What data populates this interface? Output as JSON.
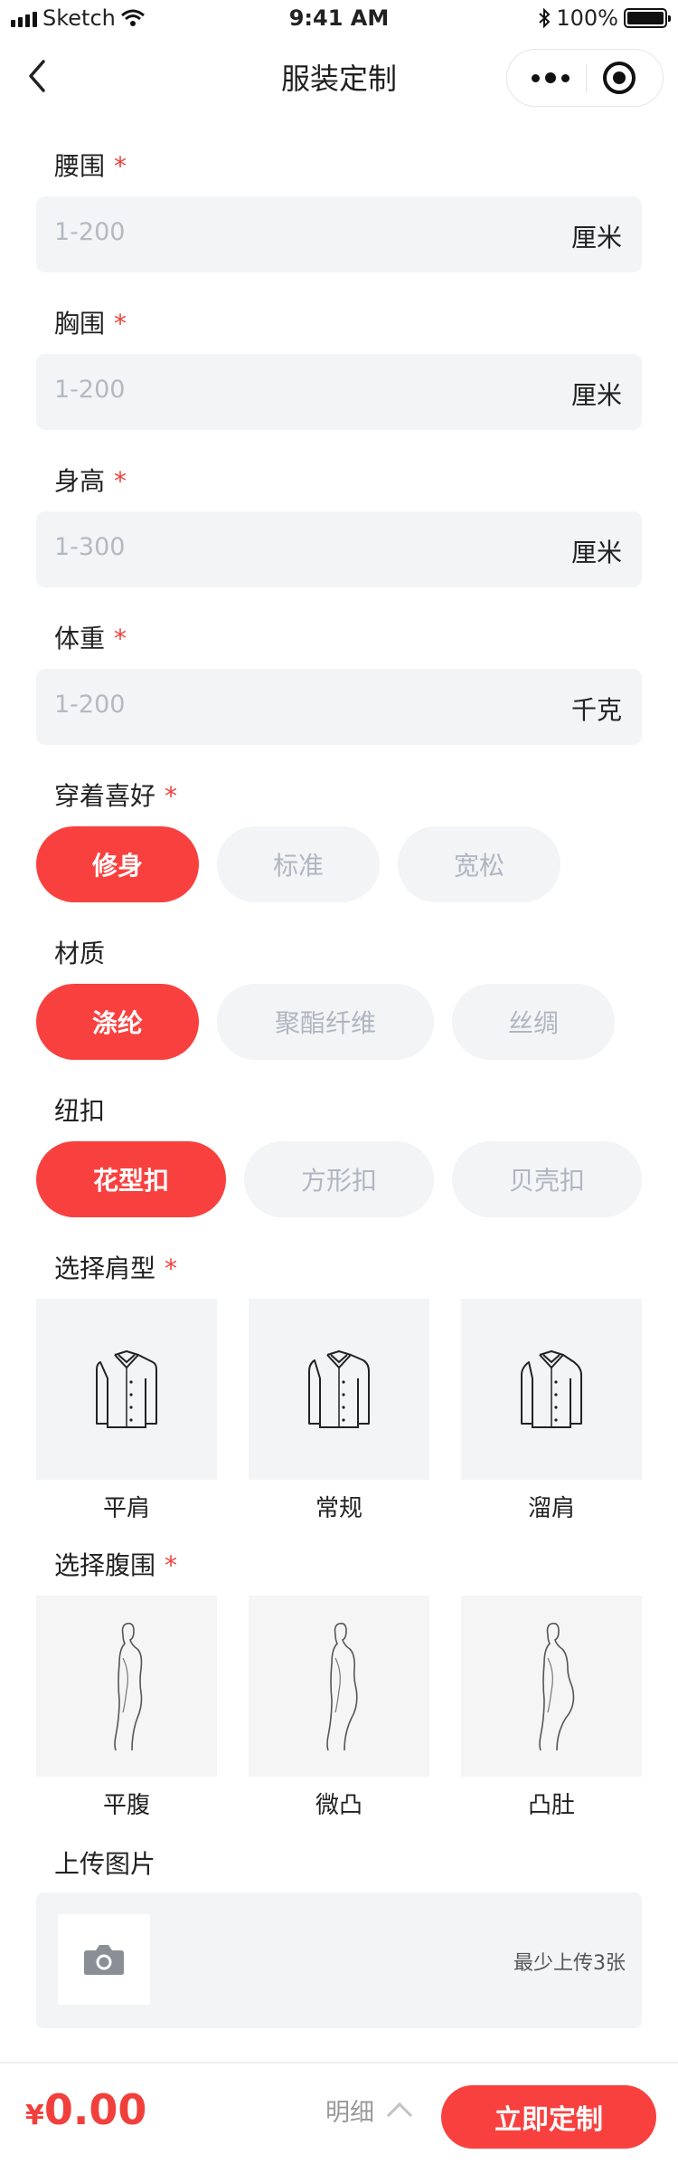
{
  "status_bar": {
    "carrier": "Sketch",
    "time": "9:41 AM",
    "battery": "100%"
  },
  "nav": {
    "title": "服装定制"
  },
  "measurements": [
    {
      "label": "腰围",
      "required": "*",
      "placeholder": "1-200",
      "unit": "厘米"
    },
    {
      "label": "胸围",
      "required": "*",
      "placeholder": "1-200",
      "unit": "厘米"
    },
    {
      "label": "身高",
      "required": "*",
      "placeholder": "1-300",
      "unit": "厘米"
    },
    {
      "label": "体重",
      "required": "*",
      "placeholder": "1-200",
      "unit": "千克"
    }
  ],
  "preference": {
    "label": "穿着喜好",
    "required": "*",
    "options": [
      "修身",
      "标准",
      "宽松"
    ],
    "selected": "修身"
  },
  "material": {
    "label": "材质",
    "options": [
      "涤纶",
      "聚酯纤维",
      "丝绸"
    ],
    "selected": "涤纶"
  },
  "button_style": {
    "label": "纽扣",
    "options": [
      "花型扣",
      "方形扣",
      "贝壳扣"
    ],
    "selected": "花型扣"
  },
  "shoulder": {
    "label": "选择肩型",
    "required": "*",
    "options": [
      "平肩",
      "常规",
      "溜肩"
    ]
  },
  "belly": {
    "label": "选择腹围",
    "required": "*",
    "options": [
      "平腹",
      "微凸",
      "凸肚"
    ]
  },
  "upload": {
    "label": "上传图片",
    "hint": "最少上传3张"
  },
  "footer": {
    "currency": "¥",
    "price": "0.00",
    "detail_label": "明细",
    "cta_label": "立即定制"
  },
  "colors": {
    "accent": "#f8413f",
    "field_bg": "#f2f4f6",
    "placeholder": "#b4b9c1"
  },
  "icons": [
    "signal-icon",
    "wifi-icon",
    "bluetooth-icon",
    "battery-icon",
    "back-icon",
    "more-icon",
    "target-icon",
    "shirt-icon",
    "body-silhouette-icon",
    "camera-icon",
    "chevron-up-icon"
  ]
}
